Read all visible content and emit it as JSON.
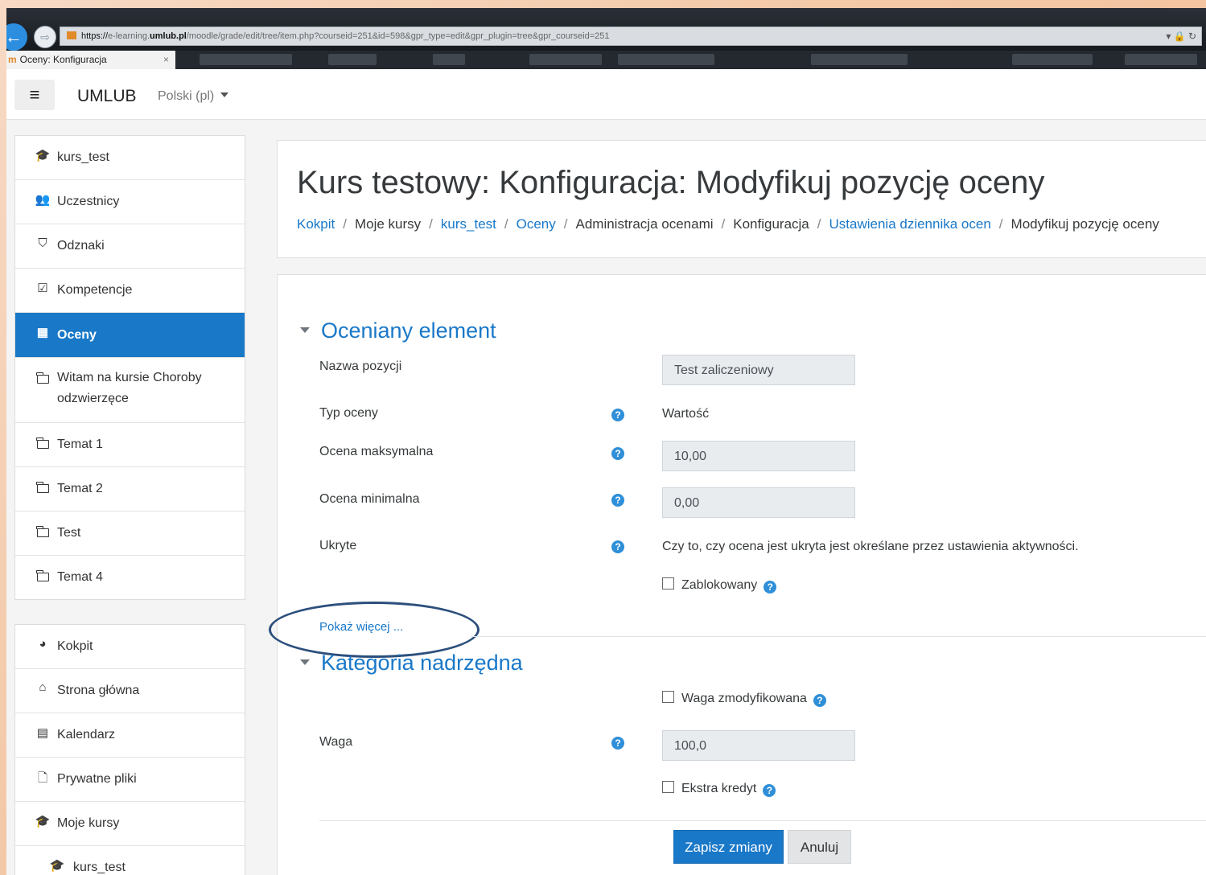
{
  "browser": {
    "url_scheme": "https://",
    "url_host_prefix": "e-learning.",
    "url_host": "umlub.pl",
    "url_path": "/moodle/grade/edit/tree/item.php?courseid=251&id=598&gpr_type=edit&gpr_plugin=tree&gpr_courseid=251",
    "tab_title": "Oceny: Konfiguracja",
    "tab_close": "×"
  },
  "navbar": {
    "menu_icon": "≡",
    "brand": "UMLUB",
    "language": "Polski (pl)"
  },
  "sidebar": {
    "course_items": [
      {
        "label": "kurs_test",
        "icon": "graduation-cap-icon",
        "glyph": "🎓"
      },
      {
        "label": "Uczestnicy",
        "icon": "users-icon",
        "glyph": "👥"
      },
      {
        "label": "Odznaki",
        "icon": "shield-icon",
        "glyph": "⛉"
      },
      {
        "label": "Kompetencje",
        "icon": "checkbox-icon",
        "glyph": "☑"
      },
      {
        "label": "Oceny",
        "icon": "table-icon",
        "glyph": "▦",
        "active": true
      },
      {
        "label": "Witam na kursie Choroby odzwierzęce",
        "icon": "folder-icon"
      },
      {
        "label": "Temat 1",
        "icon": "folder-icon"
      },
      {
        "label": "Temat 2",
        "icon": "folder-icon"
      },
      {
        "label": "Test",
        "icon": "folder-icon"
      },
      {
        "label": "Temat 4",
        "icon": "folder-icon"
      }
    ],
    "site_items": [
      {
        "label": "Kokpit",
        "icon": "dashboard-icon",
        "glyph": "◕"
      },
      {
        "label": "Strona główna",
        "icon": "home-icon",
        "glyph": "⌂"
      },
      {
        "label": "Kalendarz",
        "icon": "calendar-icon",
        "glyph": "▤"
      },
      {
        "label": "Prywatne pliki",
        "icon": "file-icon",
        "glyph": "🗋"
      },
      {
        "label": "Moje kursy",
        "icon": "graduation-cap-icon",
        "glyph": "🎓"
      },
      {
        "label": "kurs_test",
        "icon": "graduation-cap-icon",
        "glyph": "🎓"
      }
    ]
  },
  "header": {
    "title": "Kurs testowy: Konfiguracja: Modyfikuj pozycję oceny",
    "breadcrumb": [
      {
        "label": "Kokpit",
        "link": true
      },
      {
        "label": "Moje kursy",
        "link": false
      },
      {
        "label": "kurs_test",
        "link": true
      },
      {
        "label": "Oceny",
        "link": true
      },
      {
        "label": "Administracja ocenami",
        "link": false
      },
      {
        "label": "Konfiguracja",
        "link": false
      },
      {
        "label": "Ustawienia dziennika ocen",
        "link": true
      },
      {
        "label": "Modyfikuj pozycję oceny",
        "link": false
      }
    ]
  },
  "form": {
    "section1_title": "Oceniany element",
    "item_name_label": "Nazwa pozycji",
    "item_name_value": "Test zaliczeniowy",
    "grade_type_label": "Typ oceny",
    "grade_type_value": "Wartość",
    "max_grade_label": "Ocena maksymalna",
    "max_grade_value": "10,00",
    "min_grade_label": "Ocena minimalna",
    "min_grade_value": "0,00",
    "hidden_label": "Ukryte",
    "hidden_text": "Czy to, czy ocena jest ukryta jest określane przez ustawienia aktywności.",
    "locked_label": "Zablokowany",
    "show_more": "Pokaż więcej ...",
    "section2_title": "Kategoria nadrzędna",
    "weight_adjusted_label": "Waga zmodyfikowana",
    "weight_label": "Waga",
    "weight_value": "100,0",
    "extra_credit_label": "Ekstra kredyt",
    "help_glyph": "?",
    "save_button": "Zapisz zmiany",
    "cancel_button": "Anuluj"
  },
  "colors": {
    "accent": "#1978c8",
    "annotation_oval": "#2c4f7c"
  }
}
